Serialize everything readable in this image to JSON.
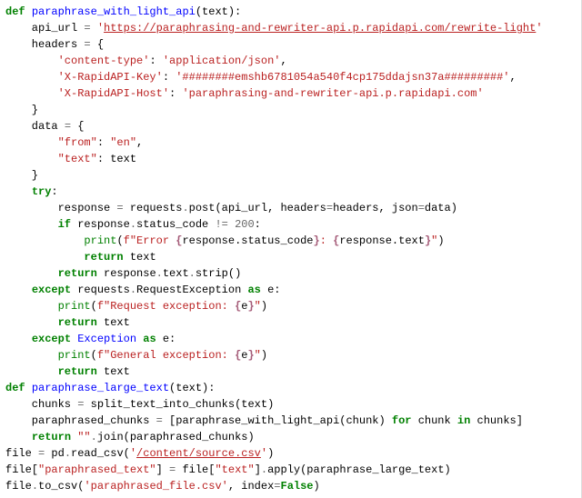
{
  "code": {
    "l1": {
      "def": "def",
      "fn": "paraphrase_with_light_api",
      "rest": "(text):"
    },
    "l2": {
      "pre": "    api_url ",
      "eq": "=",
      "sp": " ",
      "q": "'",
      "url": "https://paraphrasing-and-rewriter-api.p.rapidapi.com/rewrite-light",
      "q2": "'"
    },
    "l3": {
      "pre": "    headers ",
      "eq": "=",
      "rest": " {"
    },
    "l4": {
      "pre": "        ",
      "k": "'content-type'",
      "c": ": ",
      "v": "'application/json'",
      "t": ","
    },
    "l5": {
      "pre": "        ",
      "k": "'X-RapidAPI-Key'",
      "c": ": ",
      "v": "'########emshb6781054a540f4cp175ddajsn37a#########'",
      "t": ","
    },
    "l6": {
      "pre": "        ",
      "k": "'X-RapidAPI-Host'",
      "c": ": ",
      "v": "'paraphrasing-and-rewriter-api.p.rapidapi.com'"
    },
    "l7": "    }",
    "l8": {
      "pre": "    data ",
      "eq": "=",
      "rest": " {"
    },
    "l9": {
      "pre": "        ",
      "k": "\"from\"",
      "c": ": ",
      "v": "\"en\"",
      "t": ","
    },
    "l10": {
      "pre": "        ",
      "k": "\"text\"",
      "c": ": ",
      "v": "text"
    },
    "l11": "    }",
    "l12": {
      "pre": "    ",
      "kw": "try",
      "rest": ":"
    },
    "l13": {
      "pre": "        response ",
      "eq": "=",
      "sp": " ",
      "mod": "requests",
      "dot": ".",
      "m": "post",
      "args": "(api_url, headers",
      "eq2": "=",
      "args2": "headers, json",
      "eq3": "=",
      "args3": "data)"
    },
    "l14": {
      "pre": "        ",
      "kw": "if",
      "mid": " response",
      "dot": ".",
      "attr": "status_code ",
      "op": "!=",
      "sp": " ",
      "num": "200",
      "rest": ":"
    },
    "l15": {
      "pre": "            ",
      "fn": "print",
      "open": "(",
      "f": "f",
      "q": "\"",
      "s1": "Error ",
      "b1": "{",
      "e1": "response.status_code",
      "b2": "}",
      "s2": ": ",
      "b3": "{",
      "e2": "response.text",
      "b4": "}",
      "q2": "\"",
      "close": ")"
    },
    "l16": {
      "pre": "            ",
      "kw": "return",
      "rest": " text"
    },
    "l17": {
      "pre": "        ",
      "kw": "return",
      "mid": " response",
      "dot": ".",
      "attr": "text",
      "dot2": ".",
      "m": "strip",
      "rest": "()"
    },
    "l18": {
      "pre": "    ",
      "kw": "except",
      "mid": " requests",
      "dot": ".",
      "attr": "RequestException ",
      "as": "as",
      "rest": " e:"
    },
    "l19": {
      "pre": "        ",
      "fn": "print",
      "open": "(",
      "f": "f",
      "q": "\"",
      "s1": "Request exception: ",
      "b1": "{",
      "e1": "e",
      "b2": "}",
      "q2": "\"",
      "close": ")"
    },
    "l20": {
      "pre": "        ",
      "kw": "return",
      "rest": " text"
    },
    "l21": {
      "pre": "    ",
      "kw": "except",
      "mid": " ",
      "exc": "Exception",
      "sp": " ",
      "as": "as",
      "rest": " e:"
    },
    "l22": {
      "pre": "        ",
      "fn": "print",
      "open": "(",
      "f": "f",
      "q": "\"",
      "s1": "General exception: ",
      "b1": "{",
      "e1": "e",
      "b2": "}",
      "q2": "\"",
      "close": ")"
    },
    "l23": {
      "pre": "        ",
      "kw": "return",
      "rest": " text"
    },
    "l24": {
      "def": "def",
      "fn": "paraphrase_large_text",
      "rest": "(text):"
    },
    "l25": {
      "pre": "    chunks ",
      "eq": "=",
      "sp": " ",
      "fn": "split_text_into_chunks",
      "rest": "(text)"
    },
    "l26": {
      "pre": "    paraphrased_chunks ",
      "eq": "=",
      "sp": " [",
      "fn": "paraphrase_with_light_api",
      "mid": "(chunk) ",
      "for": "for",
      "mid2": " chunk ",
      "in": "in",
      "rest": " chunks]"
    },
    "l27": {
      "pre": "    ",
      "kw": "return",
      "sp": " ",
      "str": "\"\"",
      "dot": ".",
      "m": "join",
      "rest": "(paraphrased_chunks)"
    },
    "l28": {
      "pre": "file ",
      "eq": "=",
      "sp": " pd",
      "dot": ".",
      "m": "read_csv",
      "open": "(",
      "q": "'",
      "url": "/content/source.csv",
      "q2": "'",
      "close": ")"
    },
    "l29": {
      "pre": "file[",
      "k": "\"paraphrased_text\"",
      "mid": "] ",
      "eq": "=",
      "sp": " file[",
      "k2": "\"text\"",
      "mid2": "]",
      "dot": ".",
      "m": "apply",
      "rest": "(paraphrase_large_text)"
    },
    "l30": {
      "pre": "file",
      "dot": ".",
      "m": "to_csv",
      "open": "(",
      "str": "'paraphrased_file.csv'",
      "mid": ", index",
      "eq": "=",
      "bool": "False",
      "close": ")"
    }
  }
}
